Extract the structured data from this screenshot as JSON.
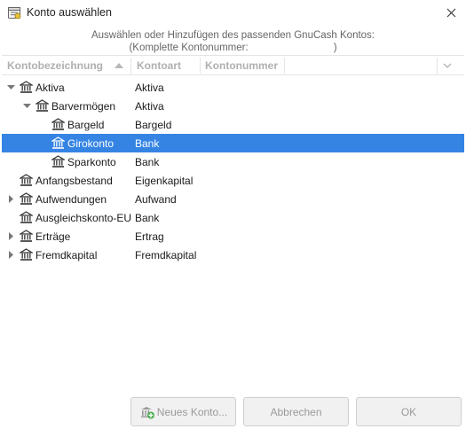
{
  "window": {
    "title": "Konto auswählen",
    "icon": "gnucash-app-icon"
  },
  "instructions": {
    "line1": "Auswählen oder Hinzufügen des passenden GnuCash Kontos:",
    "line2_prefix": "(Komplette Kontonummer:",
    "line2_suffix": ")"
  },
  "columns": {
    "name": "Kontobezeichnung",
    "type": "Kontoart",
    "number": "Kontonummer"
  },
  "accounts": [
    {
      "name": "Aktiva",
      "type": "Aktiva",
      "depth": 0,
      "expander": "expanded",
      "selected": false
    },
    {
      "name": "Barvermögen",
      "type": "Aktiva",
      "depth": 1,
      "expander": "expanded",
      "selected": false
    },
    {
      "name": "Bargeld",
      "type": "Bargeld",
      "depth": 2,
      "expander": "none",
      "selected": false
    },
    {
      "name": "Girokonto",
      "type": "Bank",
      "depth": 2,
      "expander": "none",
      "selected": true
    },
    {
      "name": "Sparkonto",
      "type": "Bank",
      "depth": 2,
      "expander": "none",
      "selected": false
    },
    {
      "name": "Anfangsbestand",
      "type": "Eigenkapital",
      "depth": 0,
      "expander": "none",
      "selected": false
    },
    {
      "name": "Aufwendungen",
      "type": "Aufwand",
      "depth": 0,
      "expander": "collapsed",
      "selected": false
    },
    {
      "name": "Ausgleichskonto-EU",
      "type": "Bank",
      "depth": 0,
      "expander": "none",
      "selected": false
    },
    {
      "name": "Erträge",
      "type": "Ertrag",
      "depth": 0,
      "expander": "collapsed",
      "selected": false
    },
    {
      "name": "Fremdkapital",
      "type": "Fremdkapital",
      "depth": 0,
      "expander": "collapsed",
      "selected": false
    }
  ],
  "buttons": {
    "new_account": "Neues Konto...",
    "cancel": "Abbrechen",
    "ok": "OK"
  },
  "colors": {
    "selection": "#3584e4",
    "header_text": "#b0b0b0",
    "disabled_button_text": "#9a9a9a"
  }
}
